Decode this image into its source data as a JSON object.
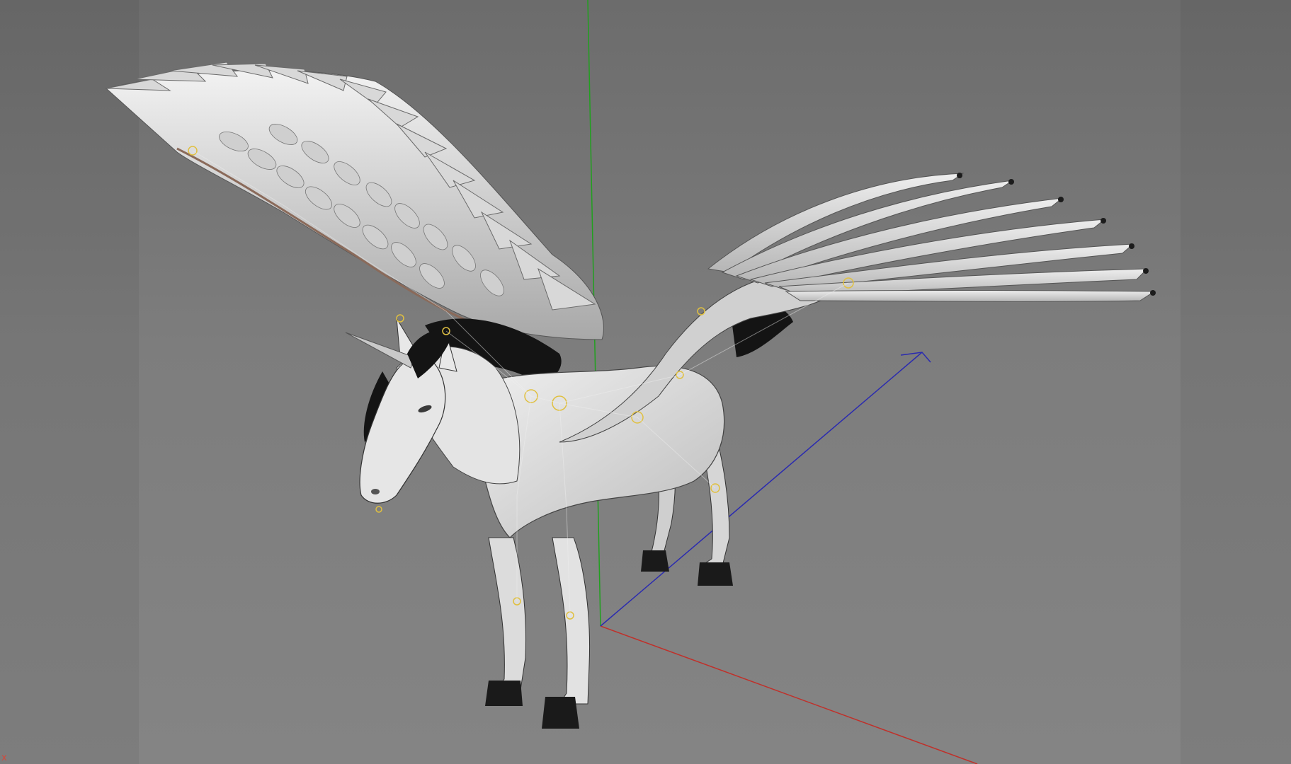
{
  "viewport": {
    "background": "#7a7a7a",
    "axis_label": "x"
  },
  "colors": {
    "x_axis": "#c0302a",
    "y_axis": "#21a01f",
    "z_axis": "#2a2ab0",
    "rig_joint": "#e0c040",
    "model_body": "#dcdcdc",
    "mane": "#141414"
  },
  "icons": {
    "axis_gizmo": "axis-gizmo-icon",
    "joint": "rig-joint-icon"
  }
}
